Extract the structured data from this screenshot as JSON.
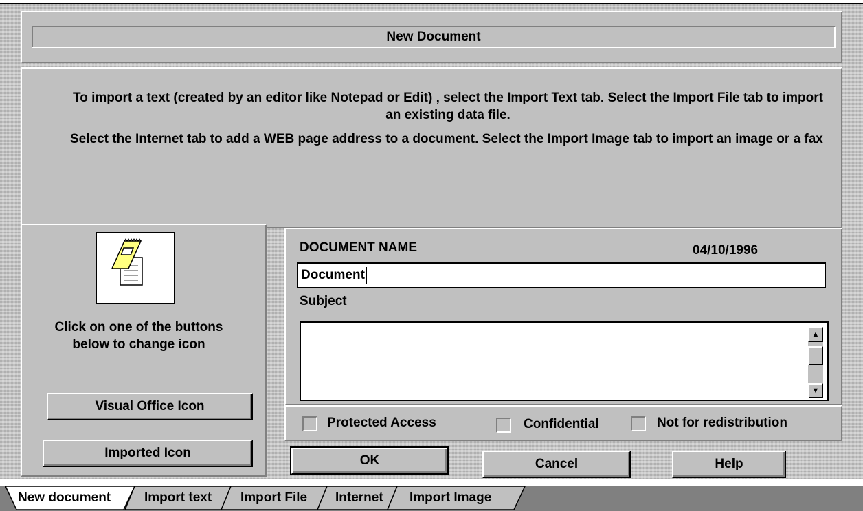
{
  "dialog": {
    "title": "New Document",
    "instructions": {
      "line1": "To import a text (created by an editor like Notepad or Edit) , select the Import Text tab.  Select the Import File tab to import an existing data file.",
      "line2": "Select the Internet tab to add a WEB page address to a document. Select the Import Image tab to import an image or a fax"
    }
  },
  "icon_panel": {
    "hint": "Click on one of the buttons below to change icon",
    "visual_office_button": "Visual Office Icon",
    "imported_button": "Imported Icon",
    "icon_name": "document-notepad-icon"
  },
  "document_form": {
    "name_label": "DOCUMENT NAME",
    "date": "04/10/1996",
    "name_value": "Document",
    "subject_label": "Subject",
    "subject_value": ""
  },
  "options": {
    "protected_access": "Protected Access",
    "confidential": "Confidential",
    "not_for_redistribution": "Not for redistribution"
  },
  "buttons": {
    "ok": "OK",
    "cancel": "Cancel",
    "help": "Help"
  },
  "tabs": [
    "New document",
    "Import text",
    "Import File",
    "Internet",
    "Import Image"
  ],
  "active_tab": "New document",
  "colors": {
    "face": "#c0c0c0",
    "tabbar": "#808080",
    "icon_yellow": "#ffff80"
  }
}
